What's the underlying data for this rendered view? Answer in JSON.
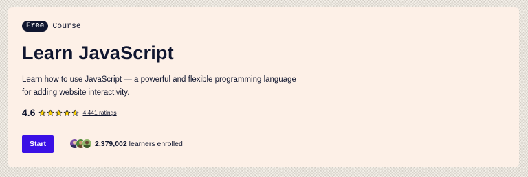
{
  "course": {
    "badge": "Free",
    "type": "Course",
    "title": "Learn JavaScript",
    "description": "Learn how to use JavaScript — a powerful and flexible programming language for adding website interactivity.",
    "rating_value": "4.6",
    "rating_stars": 4.6,
    "ratings_count": "4,441 ratings",
    "start_label": "Start",
    "learners_count": "2,379,002",
    "learners_text": "learners enrolled"
  },
  "colors": {
    "card_background": "#fdf0e7",
    "navy": "#10162f",
    "primary_button": "#3a10e5",
    "star_fill": "#ffd300"
  },
  "icons": [
    "star-icon",
    "learner-avatar"
  ]
}
